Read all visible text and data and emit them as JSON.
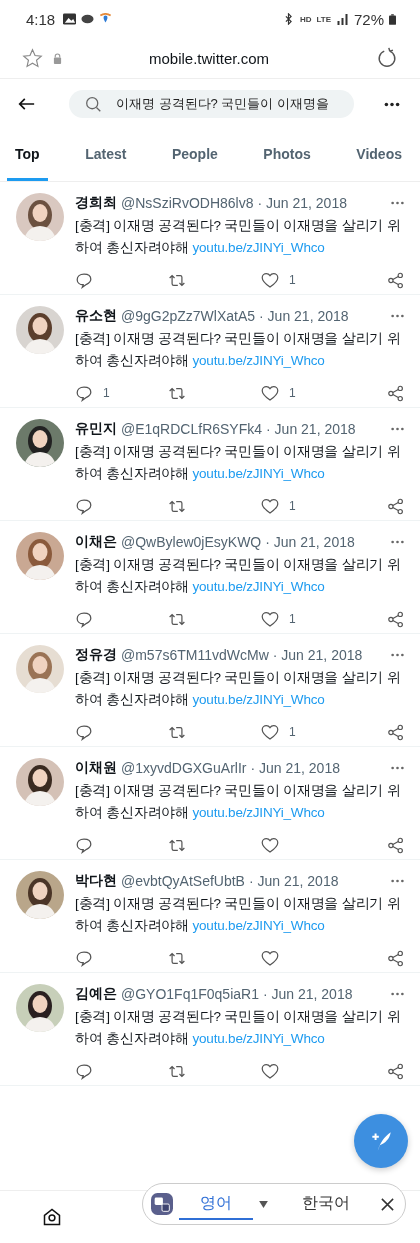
{
  "status_bar": {
    "time": "4:18",
    "hd": "HD",
    "network": "LTE",
    "battery": "72%"
  },
  "browser": {
    "url": "mobile.twitter.com"
  },
  "search": {
    "value": "이재명 공격된다? 국민들이 이재명을"
  },
  "tabs": [
    {
      "label": "Top",
      "selected": true
    },
    {
      "label": "Latest",
      "selected": false
    },
    {
      "label": "People",
      "selected": false
    },
    {
      "label": "Photos",
      "selected": false
    },
    {
      "label": "Videos",
      "selected": false
    }
  ],
  "tweets": [
    {
      "name": "경희최",
      "handle": "@NsSziRvODH86lv8",
      "date": "· Jun 21, 2018",
      "text": "[충격] 이재명 공격된다? 국민들이 이재명을 살리기 위하여 총신자려야해",
      "link": "youtu.be/zJINYi_Whco",
      "likes": "1"
    },
    {
      "name": "유소현",
      "handle": "@9gG2pZz7WlXatA5",
      "date": "· Jun 21, 2018",
      "text": "[충격] 이재명 공격된다? 국민들이 이재명을 살리기 위하여 총신자려야해",
      "link": "youtu.be/zJINYi_Whco",
      "replies": "1",
      "likes": "1"
    },
    {
      "name": "유민지",
      "handle": "@E1qRDCLfR6SYFk4",
      "date": "· Jun 21, 2018",
      "text": "[충격] 이재명 공격된다? 국민들이 이재명을 살리기 위하여 총신자려야해",
      "link": "youtu.be/zJINYi_Whco",
      "likes": "1"
    },
    {
      "name": "이채은",
      "handle": "@QwBylew0jEsyKWQ",
      "date": "· Jun 21, 2018",
      "text": "[충격] 이재명 공격된다? 국민들이 이재명을 살리기 위하여 총신자려야해",
      "link": "youtu.be/zJINYi_Whco",
      "likes": "1"
    },
    {
      "name": "정유경",
      "handle": "@m57s6TM11vdWcMw",
      "date": "· Jun 21, 2018",
      "text": "[충격] 이재명 공격된다? 국민들이 이재명을 살리기 위하여 총신자려야해",
      "link": "youtu.be/zJINYi_Whco",
      "likes": "1"
    },
    {
      "name": "이채원",
      "handle": "@1xyvdDGXGuArlIr",
      "date": "· Jun 21, 2018",
      "text": "[충격] 이재명 공격된다? 국민들이 이재명을 살리기 위하여 총신자려야해",
      "link": "youtu.be/zJINYi_Whco"
    },
    {
      "name": "박다현",
      "handle": "@evbtQyAtSefUbtB",
      "date": "· Jun 21, 2018",
      "text": "[충격] 이재명 공격된다? 국민들이 이재명을 살리기 위하여 총신자려야해",
      "link": "youtu.be/zJINYi_Whco"
    },
    {
      "name": "김예은",
      "handle": "@GYO1Fq1F0q5iaR1",
      "date": "· Jun 21, 2018",
      "text": "[충격] 이재명 공격된다? 국민들이 이재명을 살리기 위하여 총신자려야해",
      "link": "youtu.be/zJINYi_Whco"
    }
  ],
  "translate_bar": {
    "languages": [
      {
        "label": "영어",
        "selected": true
      },
      {
        "label": "한국어",
        "selected": false
      }
    ]
  }
}
